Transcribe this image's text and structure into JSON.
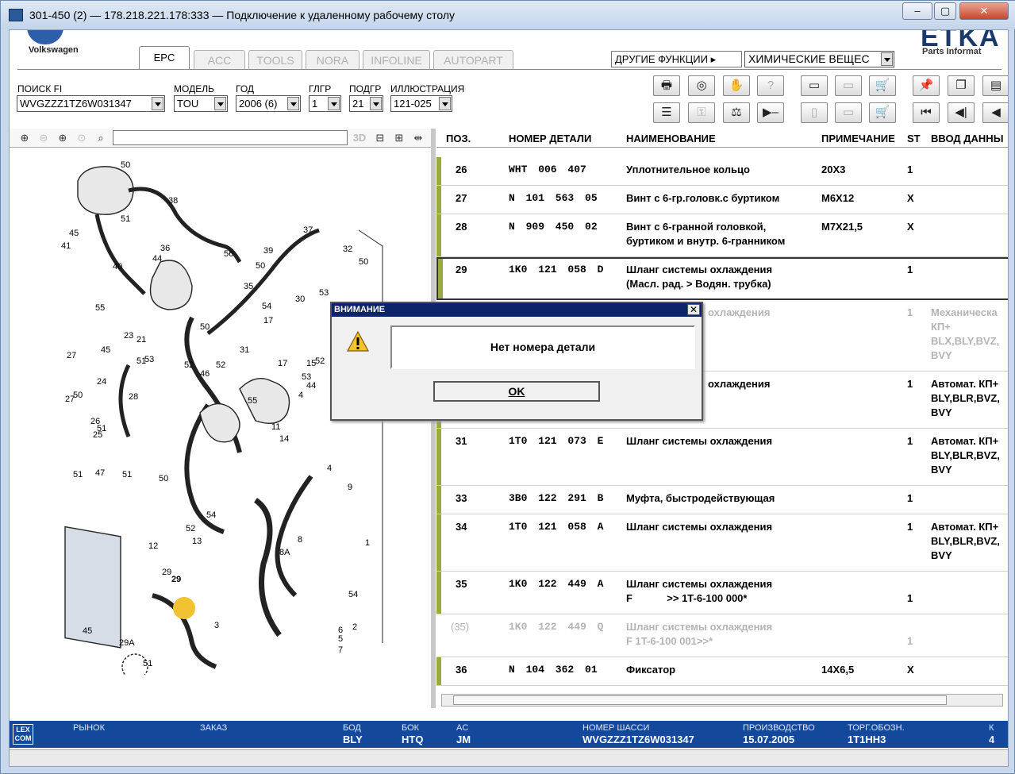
{
  "window": {
    "title": "301-450 (2) — 178.218.221.178:333 — Подключение к удаленному рабочему столу",
    "minimize": "–",
    "restore": "▢",
    "close": "✕"
  },
  "brand": {
    "name": "Volkswagen",
    "logo_text": "ETKA",
    "logo_subtitle": "Parts Informat"
  },
  "tabs": [
    {
      "label": "EPC",
      "active": true
    },
    {
      "label": "ACC",
      "active": false
    },
    {
      "label": "TOOLS",
      "active": false
    },
    {
      "label": "NORA",
      "active": false
    },
    {
      "label": "INFOLINE",
      "active": false
    },
    {
      "label": "AUTOPART",
      "active": false
    }
  ],
  "other_functions": {
    "label": "ДРУГИЕ ФУНКЦИИ",
    "value": "ХИМИЧЕСКИЕ ВЕЩЕС"
  },
  "filters": {
    "search_label": "ПОИСК FI",
    "search_value": "WVGZZZ1TZ6W031347",
    "model_label": "МОДЕЛЬ",
    "model_value": "TOU",
    "year_label": "ГОД",
    "year_value": "2006 (6)",
    "group_label": "ГЛГР",
    "group_value": "1",
    "subgroup_label": "ПОДГР",
    "subgroup_value": "21",
    "illustration_label": "ИЛЛЮСТРАЦИЯ",
    "illustration_value": "121-025"
  },
  "diagram_toolbar": {
    "btn_3d": "3D"
  },
  "parts_table": {
    "headers": {
      "pos": "ПОЗ.",
      "number": "НОМЕР ДЕТАЛИ",
      "name": "НАИМЕНОВАНИЕ",
      "note": "ПРИМЕЧАНИЕ",
      "st": "ST",
      "input": "ВВОД ДАННЫ"
    },
    "rows": [
      {
        "pos": "26",
        "number": "WHT 006 407",
        "name1": "Уплотнительное кольцо",
        "name2": "",
        "note": "20X3",
        "st": "1",
        "info1": "",
        "info2": "",
        "info3": ""
      },
      {
        "pos": "27",
        "number": "N 101 563 05",
        "name1": "Винт с 6-гр.головк.с буртиком",
        "name2": "",
        "note": "M6X12",
        "st": "X",
        "info1": "",
        "info2": "",
        "info3": ""
      },
      {
        "pos": "28",
        "number": "N 909 450 02",
        "name1": "Винт с 6-гранной головкой,",
        "name2": "буртиком и внутр. 6-гранником",
        "note": "M7X21,5",
        "st": "X",
        "info1": "",
        "info2": "",
        "info3": ""
      },
      {
        "pos": "29",
        "number": "1K0 121 058 D",
        "name1": "Шланг системы охлаждения",
        "name2": "(Масл. рад. > Водян. трубка)",
        "note": "",
        "st": "1",
        "info1": "",
        "info2": "",
        "info3": ""
      },
      {
        "pos": "",
        "number": "",
        "name1": "охлаждения",
        "name2": "",
        "note": "",
        "st": "1",
        "info1": "Механическа",
        "info2": "КП+",
        "info3": "BLX,BLY,BVZ,",
        "info4": "BVY"
      },
      {
        "pos": "",
        "number": "",
        "name1": "охлаждения",
        "name2": "",
        "note": "",
        "st": "1",
        "info1": "Автомат. КП+",
        "info2": "BLY,BLR,BVZ,",
        "info3": "BVY"
      },
      {
        "pos": "31",
        "number": "1T0 121 073 E",
        "name1": "Шланг системы охлаждения",
        "name2": "",
        "note": "",
        "st": "1",
        "info1": "Автомат. КП+",
        "info2": "BLY,BLR,BVZ,",
        "info3": "BVY"
      },
      {
        "pos": "33",
        "number": "3B0 122 291 B",
        "name1": "Муфта, быстродействующая",
        "name2": "",
        "note": "",
        "st": "1",
        "info1": "",
        "info2": "",
        "info3": ""
      },
      {
        "pos": "34",
        "number": "1T0 121 058 A",
        "name1": "Шланг системы охлаждения",
        "name2": "",
        "note": "",
        "st": "1",
        "info1": "Автомат. КП+",
        "info2": "BLY,BLR,BVZ,",
        "info3": "BVY"
      },
      {
        "pos": "35",
        "number": "1K0 122 449 A",
        "name1": "Шланг системы охлаждения",
        "name2": "F            >> 1T-6-100 000*",
        "note": "",
        "st": "1",
        "info1": "",
        "info2": "",
        "info3": ""
      },
      {
        "pos": "(35)",
        "number": "1K0 122 449 Q",
        "name1": "Шланг системы охлаждения",
        "name2": "F 1T-6-100 001>>*",
        "note": "",
        "st": "1",
        "info1": "",
        "info2": "",
        "info3": ""
      },
      {
        "pos": "36",
        "number": "N 104 362 01",
        "name1": "Фиксатор",
        "name2": "",
        "note": "14X6,5",
        "st": "X",
        "info1": "",
        "info2": "",
        "info3": ""
      }
    ]
  },
  "diagram_callouts": [
    "50",
    "38",
    "51",
    "45",
    "41",
    "40",
    "36",
    "56",
    "44",
    "37",
    "39",
    "50",
    "35",
    "30",
    "32",
    "50",
    "21",
    "50",
    "53",
    "55",
    "23",
    "53",
    "45",
    "51",
    "27",
    "50",
    "17",
    "52",
    "31",
    "24",
    "28",
    "51",
    "26",
    "27",
    "25",
    "4",
    "52",
    "14",
    "11",
    "51",
    "47",
    "51",
    "50",
    "52",
    "54",
    "12",
    "13",
    "29",
    "45",
    "29A",
    "51",
    "8",
    "8A",
    "3",
    "6",
    "5",
    "7",
    "1",
    "2",
    "9",
    "54",
    "54",
    "55",
    "46",
    "44",
    "15",
    "52",
    "17",
    "4",
    "53",
    "52"
  ],
  "highlight_callout": "29",
  "status_bar": {
    "logo": "LEX COM",
    "market_label": "РЫНОК",
    "order_label": "ЗАКАЗ",
    "bod_label": "БОД",
    "bod_value": "BLY",
    "bok_label": "БОК",
    "bok_value": "HTQ",
    "ac_label": "AC",
    "ac_value": "JM",
    "chassis_label": "НОМЕР ШАССИ",
    "chassis_value": "WVGZZZ1TZ6W031347",
    "production_label": "ПРОИЗВОДСТВО",
    "production_value": "15.07.2005",
    "trade_label": "ТОРГ.ОБОЗН.",
    "trade_value": "1T1HH3",
    "k_label": "К",
    "k_value": "4"
  },
  "dialog": {
    "title": "ВНИМАНИЕ",
    "message": "Нет номера детали",
    "ok": "OK"
  },
  "colors": {
    "status_bg": "#13489b",
    "row_bar": "#9aaa3c",
    "dialog_title": "#0b246a",
    "callout_highlight": "#f1c232"
  }
}
